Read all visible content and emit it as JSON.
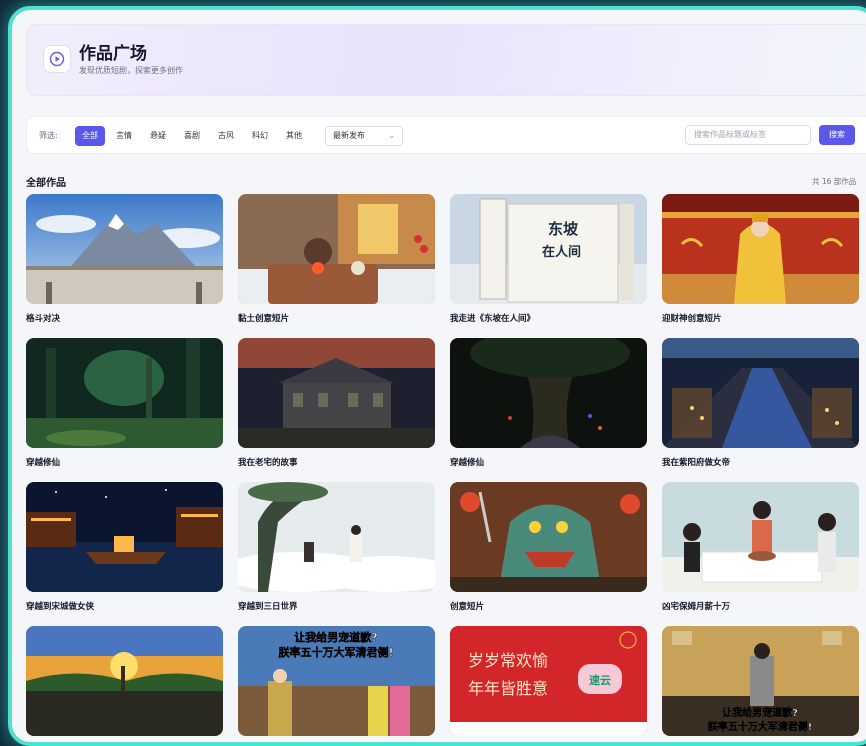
{
  "header": {
    "title": "作品广场",
    "subtitle": "发现优质短剧，探索更多创作",
    "logo_icon": "play-circle-icon"
  },
  "filters": {
    "label": "筛选:",
    "chips": [
      "全部",
      "言情",
      "悬疑",
      "喜剧",
      "古风",
      "科幻",
      "其他"
    ],
    "active_index": 0,
    "sort_value": "最新发布",
    "search_placeholder": "搜索作品标题或标签",
    "search_label": "搜索"
  },
  "section": {
    "title": "全部作品",
    "count": "共 16 部作品"
  },
  "works": [
    {
      "title": "格斗对决",
      "scene": "mountain"
    },
    {
      "title": "黏土创意短片",
      "scene": "clay"
    },
    {
      "title": "我走进《东坡在人间》",
      "scene": "book"
    },
    {
      "title": "迎财神创意短片",
      "scene": "palace"
    },
    {
      "title": "穿越修仙",
      "scene": "forest"
    },
    {
      "title": "我在老宅的故事",
      "scene": "mansion"
    },
    {
      "title": "穿越修仙",
      "scene": "darktree"
    },
    {
      "title": "我在紫阳府做女帝",
      "scene": "city"
    },
    {
      "title": "穿越到宋城做女侠",
      "scene": "night-river"
    },
    {
      "title": "穿越到三日世界",
      "scene": "cloud"
    },
    {
      "title": "创意短片",
      "scene": "dragon"
    },
    {
      "title": "凶宅保姆月薪十万",
      "scene": "family"
    },
    {
      "title": "",
      "scene": "sunset-army"
    },
    {
      "title": "",
      "scene": "poster-archer",
      "poster_text": [
        "让我给男宠道歉?",
        "朕率五十万大军清君侧!"
      ]
    },
    {
      "title": "",
      "scene": "red-banner",
      "poster_text": [
        "岁岁常欢愉",
        "年年皆胜意"
      ],
      "badge": "速云"
    },
    {
      "title": "",
      "scene": "warrior",
      "poster_text": [
        "让我给男宠道歉?",
        "朕率五十万大军清君侧!"
      ]
    }
  ],
  "book_text": [
    "东坡",
    "在人间"
  ],
  "colors": {
    "accent": "#5b57e8",
    "frame": "#4fe0cf"
  }
}
